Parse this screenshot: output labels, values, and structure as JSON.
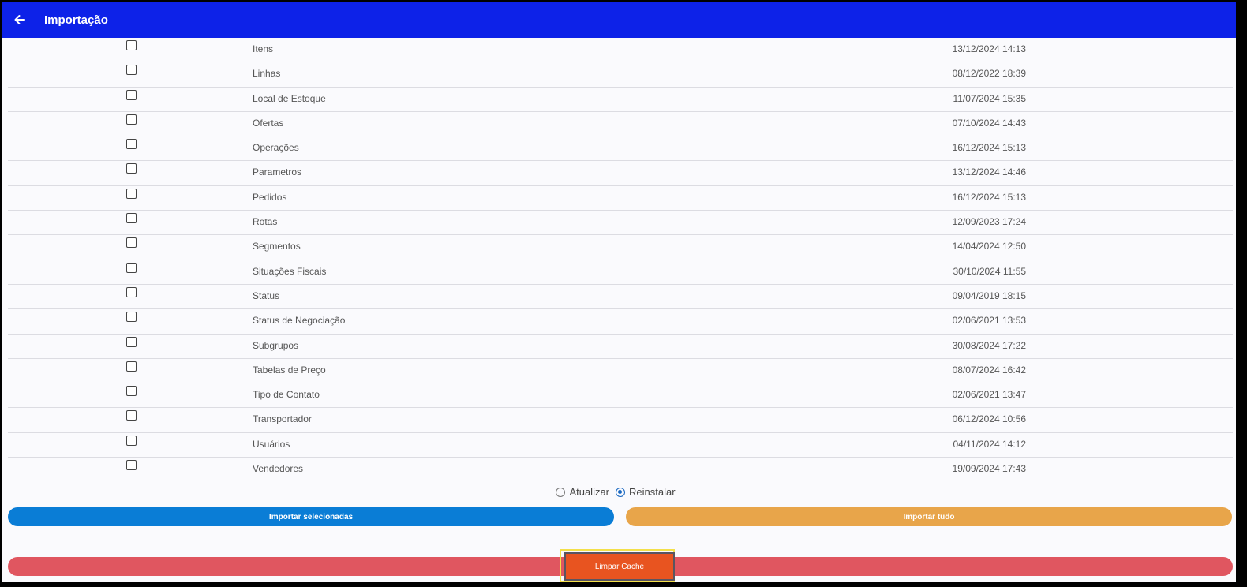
{
  "appbar": {
    "title": "Importação",
    "back_icon": "arrow-left-icon",
    "color": "#0d22e8"
  },
  "rows": [
    {
      "name": "Itens",
      "date": "13/12/2024 14:13",
      "checked": false
    },
    {
      "name": "Linhas",
      "date": "08/12/2022 18:39",
      "checked": false
    },
    {
      "name": "Local de Estoque",
      "date": "11/07/2024 15:35",
      "checked": false
    },
    {
      "name": "Ofertas",
      "date": "07/10/2024 14:43",
      "checked": false
    },
    {
      "name": "Operações",
      "date": "16/12/2024 15:13",
      "checked": false
    },
    {
      "name": "Parametros",
      "date": "13/12/2024 14:46",
      "checked": false
    },
    {
      "name": "Pedidos",
      "date": "16/12/2024 15:13",
      "checked": false
    },
    {
      "name": "Rotas",
      "date": "12/09/2023 17:24",
      "checked": false
    },
    {
      "name": "Segmentos",
      "date": "14/04/2024 12:50",
      "checked": false
    },
    {
      "name": "Situações Fiscais",
      "date": "30/10/2024 11:55",
      "checked": false
    },
    {
      "name": "Status",
      "date": "09/04/2019 18:15",
      "checked": false
    },
    {
      "name": "Status de Negociação",
      "date": "02/06/2021 13:53",
      "checked": false
    },
    {
      "name": "Subgrupos",
      "date": "30/08/2024 17:22",
      "checked": false
    },
    {
      "name": "Tabelas de Preço",
      "date": "08/07/2024 16:42",
      "checked": false
    },
    {
      "name": "Tipo de Contato",
      "date": "02/06/2021 13:47",
      "checked": false
    },
    {
      "name": "Transportador",
      "date": "06/12/2024 10:56",
      "checked": false
    },
    {
      "name": "Usuários",
      "date": "04/11/2024 14:12",
      "checked": false
    },
    {
      "name": "Vendedores",
      "date": "19/09/2024 17:43",
      "checked": false
    }
  ],
  "mode": {
    "options": [
      {
        "label": "Atualizar",
        "selected": false
      },
      {
        "label": "Reinstalar",
        "selected": true
      }
    ]
  },
  "buttons": {
    "import_selected": "Importar selecionadas",
    "import_all": "Importar tudo",
    "clear_cache": "Limpar Cache"
  },
  "colors": {
    "import_selected": "#0a7dd6",
    "import_all": "#e8a54a",
    "clear_cache": "#e05660",
    "clear_cache_highlight": "#e85420"
  }
}
